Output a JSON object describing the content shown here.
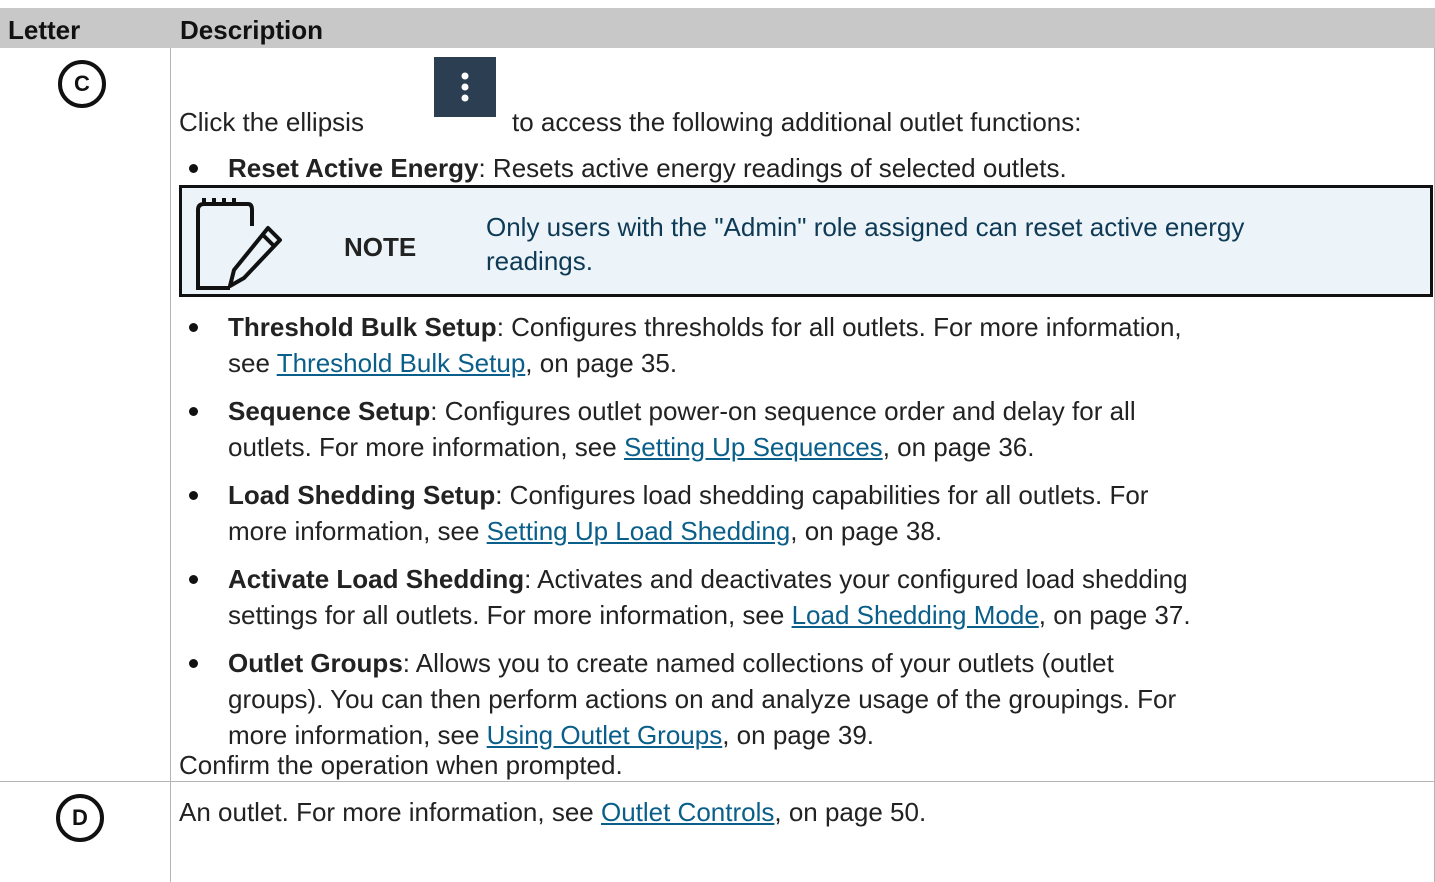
{
  "header": {
    "letter": "Letter",
    "description": "Description"
  },
  "row_c": {
    "letter": "C",
    "intro_before": "Click the ellipsis",
    "intro_after": "to access the following additional outlet functions:",
    "ellipsis_icon": "vertical-ellipsis-icon",
    "items": [
      {
        "title": "Reset Active Energy",
        "text": ": Resets active energy readings of selected outlets."
      },
      {
        "title": "Threshold Bulk Setup",
        "text1": ": Configures thresholds for all outlets. For more information,",
        "pre": "see ",
        "link": "Threshold Bulk Setup",
        "post": ", on page 35."
      },
      {
        "title": "Sequence Setup",
        "text1": ": Configures outlet power-on sequence order and delay for all",
        "pre": "outlets. For more information, see ",
        "link": "Setting Up Sequences",
        "post": ", on page 36."
      },
      {
        "title": "Load Shedding Setup",
        "text1": ": Configures load shedding capabilities for all outlets. For",
        "pre": "more information, see ",
        "link": "Setting Up Load Shedding",
        "post": ", on page 38."
      },
      {
        "title": "Activate Load Shedding",
        "text1": ": Activates and deactivates your configured load shedding",
        "pre": "settings for all outlets. For more information, see ",
        "link": "Load Shedding Mode",
        "post": ", on page 37."
      },
      {
        "title": "Outlet Groups",
        "text1": ": Allows you to create named collections of your outlets (outlet",
        "line2": "groups). You can then perform actions on and analyze usage of the groupings. For",
        "pre": "more information, see ",
        "link": "Using Outlet Groups",
        "post": ", on page 39."
      }
    ],
    "note": {
      "label": "NOTE",
      "line1": "Only users with the \"Admin\" role assigned can reset active energy",
      "line2": "readings.",
      "icon": "note-pencil-icon"
    },
    "confirm": "Confirm the operation when prompted."
  },
  "row_d": {
    "letter": "D",
    "pre": "An outlet. For more information, see ",
    "link": "Outlet Controls",
    "post": ", on page 50."
  },
  "colors": {
    "header_bg": "#c8c8c8",
    "link": "#0a5f8a",
    "note_bg": "#ecf4f9",
    "icon_bg": "#2c3e52"
  }
}
